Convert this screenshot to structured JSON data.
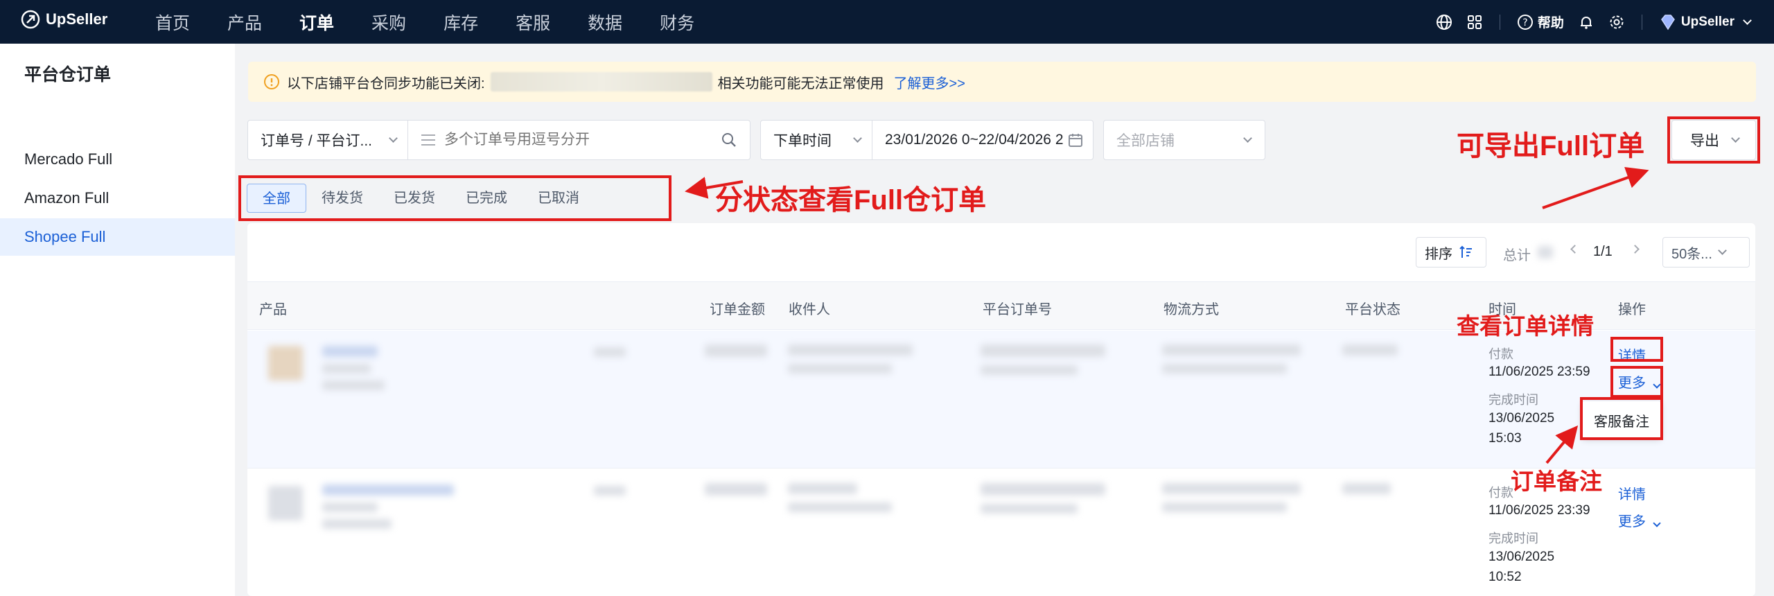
{
  "app": {
    "name": "UpSeller"
  },
  "nav": {
    "items": [
      "首页",
      "产品",
      "订单",
      "采购",
      "库存",
      "客服",
      "数据",
      "财务"
    ],
    "active_index": 2,
    "help": "帮助",
    "user": "UpSeller"
  },
  "sidebar": {
    "title": "平台仓订单",
    "items": [
      "Mercado Full",
      "Amazon Full",
      "Shopee Full"
    ],
    "active_index": 2
  },
  "notice": {
    "prefix": "以下店铺平台仓同步功能已关闭:",
    "suffix": "相关功能可能无法正常使用",
    "link": "了解更多>>"
  },
  "filters": {
    "search_type": "订单号 / 平台订...",
    "search_placeholder": "多个订单号用逗号分开",
    "time_type": "下单时间",
    "date_range": "23/01/2026 0~22/04/2026 2",
    "store_placeholder": "全部店铺",
    "export": "导出"
  },
  "tabs": [
    "全部",
    "待发货",
    "已发货",
    "已完成",
    "已取消"
  ],
  "toolbar": {
    "sort": "排序",
    "total": "总计",
    "page": "1/1",
    "page_size": "50条..."
  },
  "table": {
    "headers": [
      "产品",
      "订单金额",
      "收件人",
      "平台订单号",
      "物流方式",
      "平台状态",
      "时间",
      "操作"
    ],
    "rows": [
      {
        "paid_label": "付款",
        "paid_time": "11/06/2025 23:59",
        "done_label": "完成时间",
        "done_date": "13/06/2025",
        "done_time": "15:03",
        "detail": "详情",
        "more": "更多"
      },
      {
        "paid_label": "付款",
        "paid_time": "11/06/2025 23:39",
        "done_label": "完成时间",
        "done_date": "13/06/2025",
        "done_time": "10:52",
        "detail": "详情",
        "more": "更多"
      }
    ],
    "popup": "客服备注"
  },
  "annotations": {
    "export": "可导出Full订单",
    "tabs": "分状态查看Full仓订单",
    "detail": "查看订单详情",
    "note": "订单备注"
  },
  "colors": {
    "nav_bg": "#0a1b33",
    "accent": "#1a5fd6",
    "annotation": "#e21b1b",
    "notice_bg": "#fff7e0"
  }
}
